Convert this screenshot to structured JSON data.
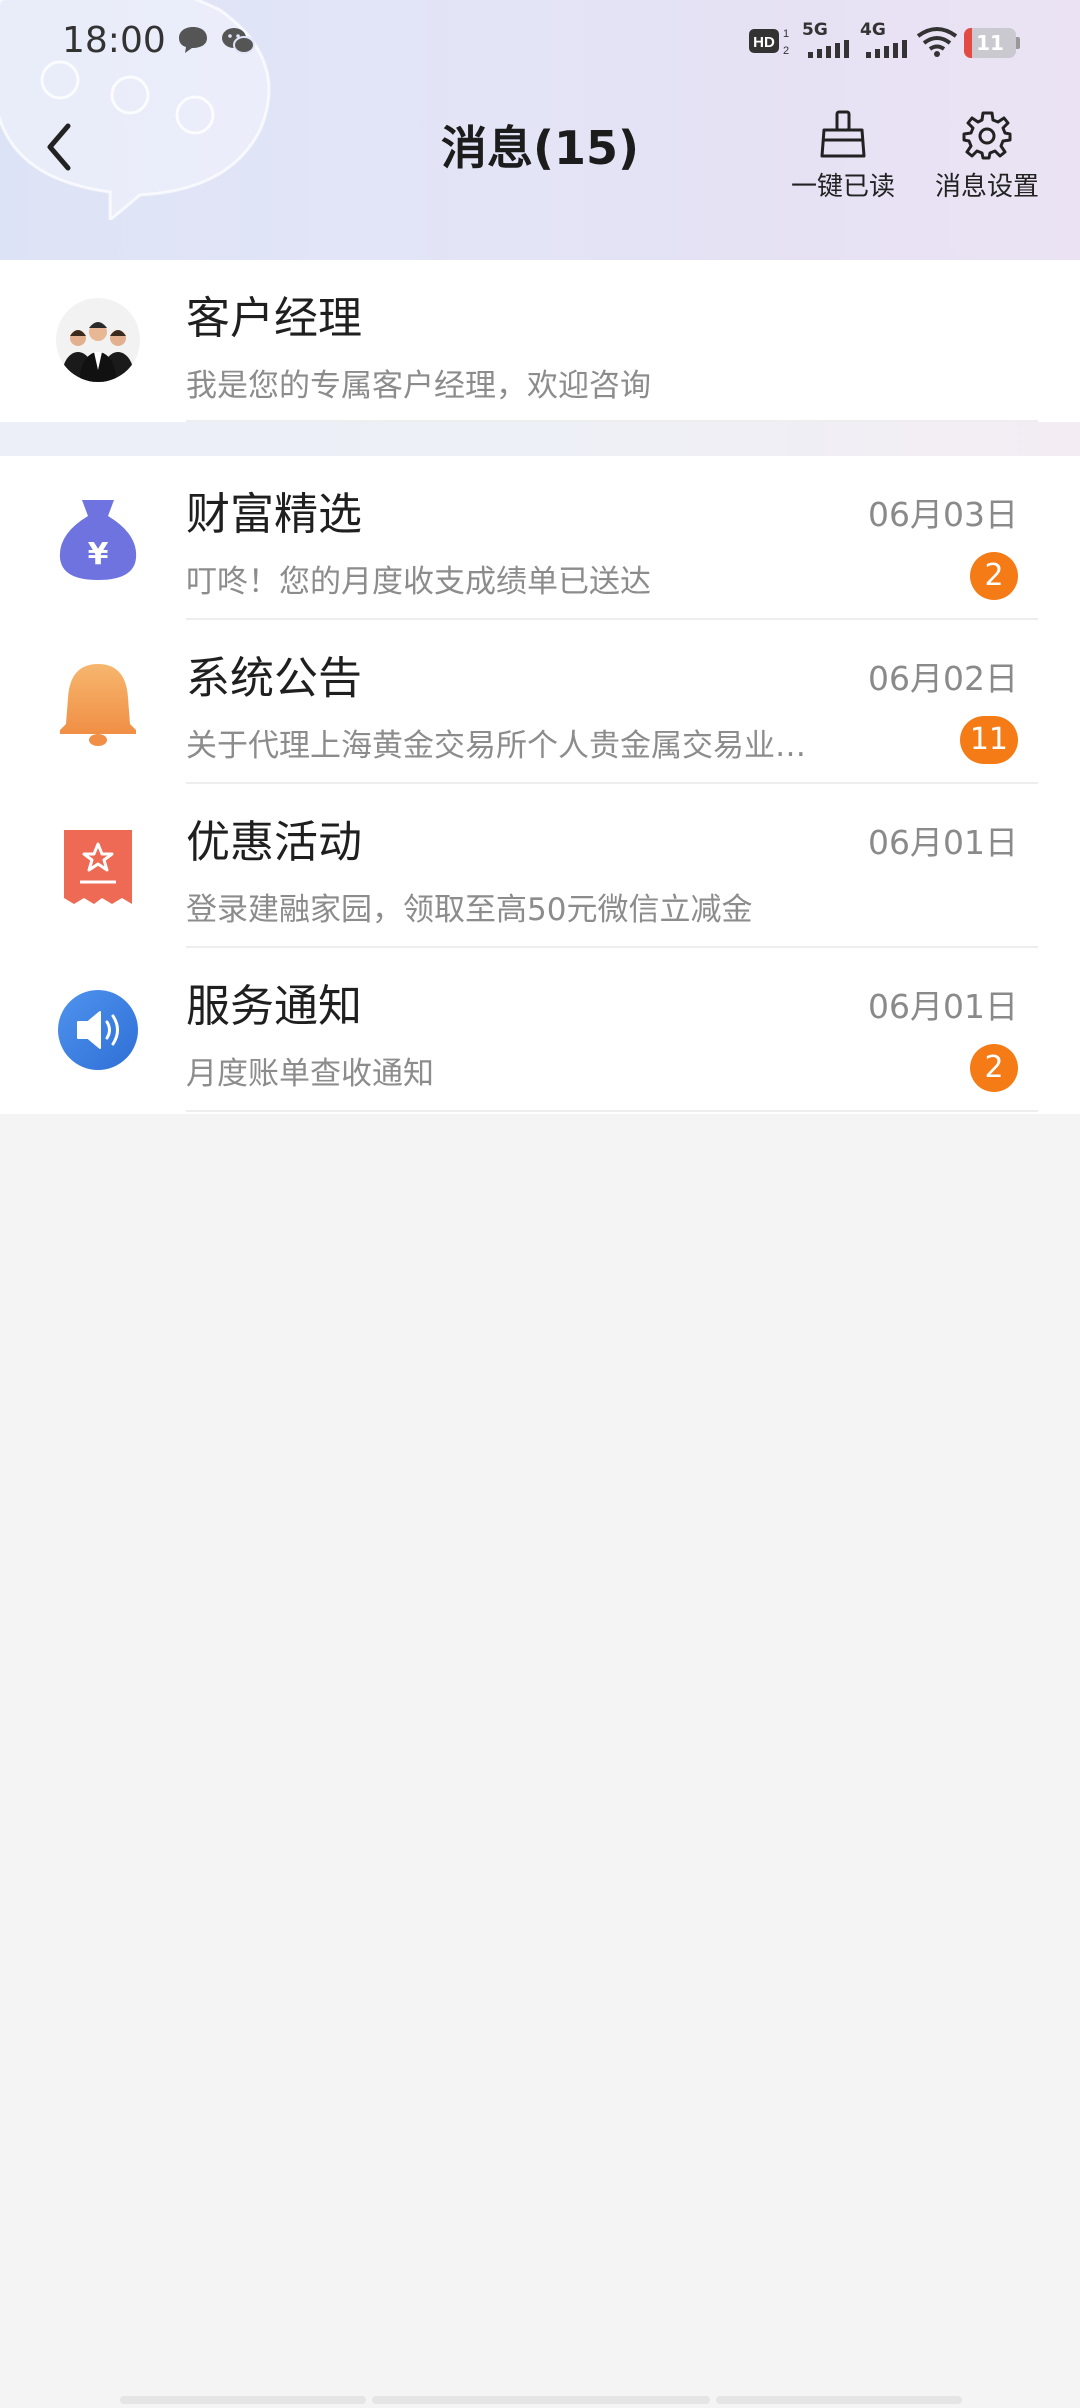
{
  "status_bar": {
    "time": "18:00",
    "network_1": "5G",
    "network_2": "4G",
    "battery": "11"
  },
  "nav": {
    "title": "消息(15)",
    "mark_read_label": "一键已读",
    "settings_label": "消息设置"
  },
  "manager": {
    "title": "客户经理",
    "subtitle": "我是您的专属客户经理，欢迎咨询"
  },
  "messages": [
    {
      "title": "财富精选",
      "subtitle": "叮咚！您的月度收支成绩单已送达",
      "date": "06月03日",
      "badge": "2",
      "icon": "money-bag-icon",
      "color": "#6f73e0"
    },
    {
      "title": "系统公告",
      "subtitle": "关于代理上海黄金交易所个人贵金属交易业…",
      "date": "06月02日",
      "badge": "11",
      "icon": "bell-icon",
      "color": "#f4a45a"
    },
    {
      "title": "优惠活动",
      "subtitle": "登录建融家园，领取至高50元微信立减金",
      "date": "06月01日",
      "badge": "",
      "icon": "coupon-icon",
      "color": "#ee6a55"
    },
    {
      "title": "服务通知",
      "subtitle": "月度账单查收通知",
      "date": "06月01日",
      "badge": "2",
      "icon": "speaker-icon",
      "color": "#3d7fe0"
    }
  ],
  "colors": {
    "badge": "#f57b16",
    "background": "#f4f4f5"
  }
}
